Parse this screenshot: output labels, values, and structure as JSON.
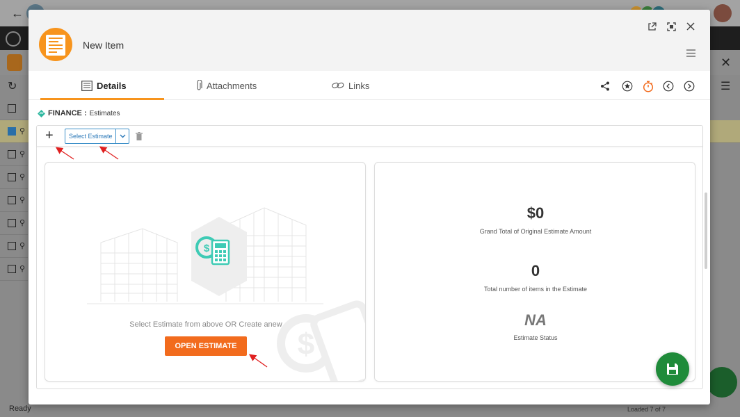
{
  "modal": {
    "title": "New Item"
  },
  "tabs": [
    {
      "label": "Details",
      "active": true
    },
    {
      "label": "Attachments",
      "active": false
    },
    {
      "label": "Links",
      "active": false
    }
  ],
  "section": {
    "category": "FINANCE :",
    "name": "Estimates"
  },
  "toolbar": {
    "select_label": "Select Estimate"
  },
  "left_card": {
    "message": "Select Estimate from above OR Create anew",
    "button_label": "OPEN ESTIMATE"
  },
  "right_card": {
    "grand_total_value": "$0",
    "grand_total_label": "Grand Total of Original Estimate Amount",
    "item_count_value": "0",
    "item_count_label": "Total number of items in the Estimate",
    "status_value": "NA",
    "status_label": "Estimate Status"
  },
  "background": {
    "status_text": "Ready",
    "loaded_text": "Loaded 7 of 7"
  },
  "colors": {
    "accent_orange": "#f7941d",
    "button_orange": "#f26b1d",
    "link_blue": "#2a78b8",
    "fab_green": "#1f8b3a",
    "teal_icon": "#3ecbb5"
  },
  "icons": {
    "header": [
      "external-link-icon",
      "maximize-icon",
      "close-icon",
      "hamburger-menu-icon"
    ],
    "actions": [
      "share-icon",
      "star-icon",
      "timer-icon",
      "previous-icon",
      "next-icon"
    ]
  }
}
